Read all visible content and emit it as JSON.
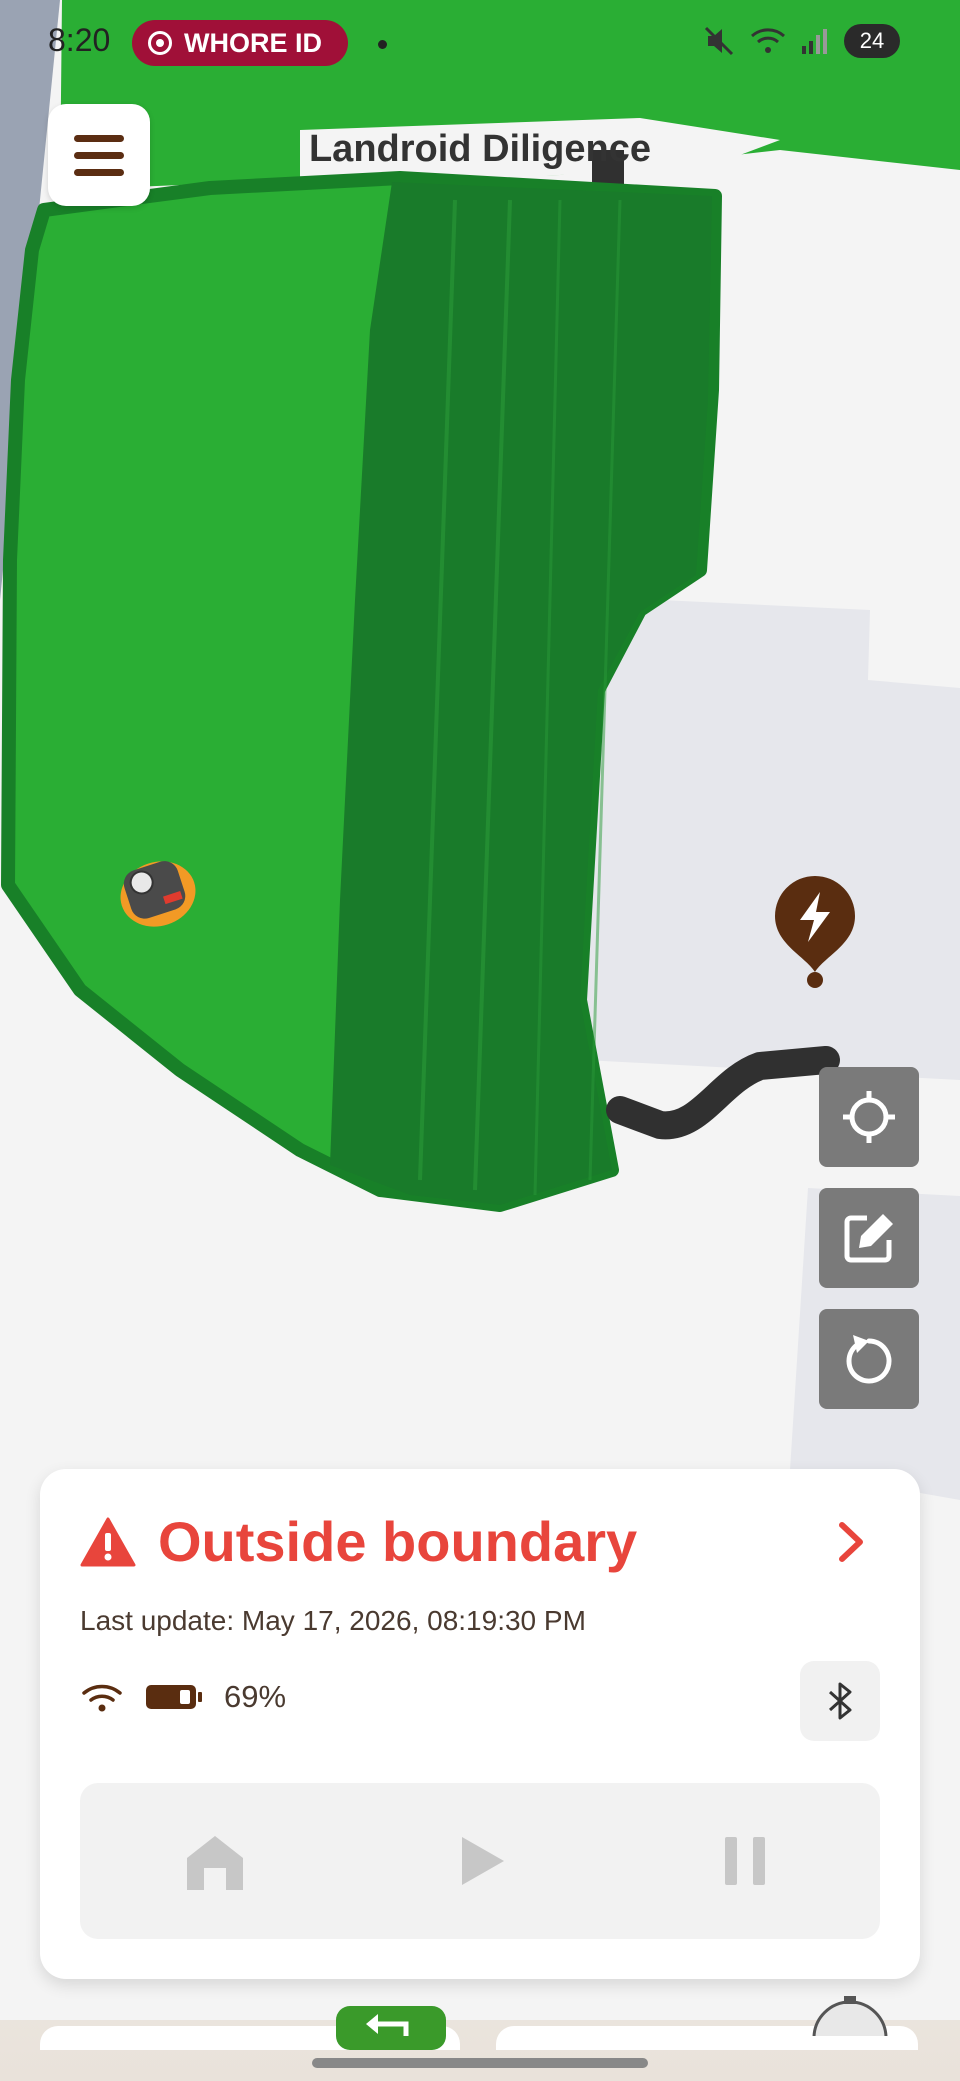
{
  "status_bar": {
    "time": "8:20",
    "recording_label": "WHORE ID",
    "battery_level": "24",
    "icons": [
      "recording-icon",
      "mute-icon",
      "wifi-signal-icon",
      "cell-signal-icon",
      "battery-icon"
    ]
  },
  "header": {
    "title": "Landroid Diligence",
    "menu_icon": "hamburger-menu-icon"
  },
  "map": {
    "icons": [
      "mower-icon",
      "charging-station-icon"
    ],
    "colors": {
      "lawn_light": "#2aae34",
      "lawn_dark": "#197b2a",
      "outline": "#188028",
      "wire": "#303030",
      "building": "#e6e7ec",
      "station": "#5a2d10"
    }
  },
  "side_buttons": [
    {
      "icon": "locate-crosshair-icon"
    },
    {
      "icon": "edit-map-icon"
    },
    {
      "icon": "refresh-icon"
    }
  ],
  "status_card": {
    "status_text": "Outside boundary",
    "status_icon": "warning-icon",
    "last_update": "Last update: May 17, 2026, 08:19:30 PM",
    "battery_percent": "69%",
    "connectivity_icons": [
      "wifi-icon",
      "battery-icon",
      "bluetooth-icon"
    ],
    "colors": {
      "error": "#e8453c",
      "brown": "#5a2d10"
    }
  },
  "controls": [
    {
      "icon": "home-icon"
    },
    {
      "icon": "play-icon"
    },
    {
      "icon": "pause-icon"
    }
  ]
}
